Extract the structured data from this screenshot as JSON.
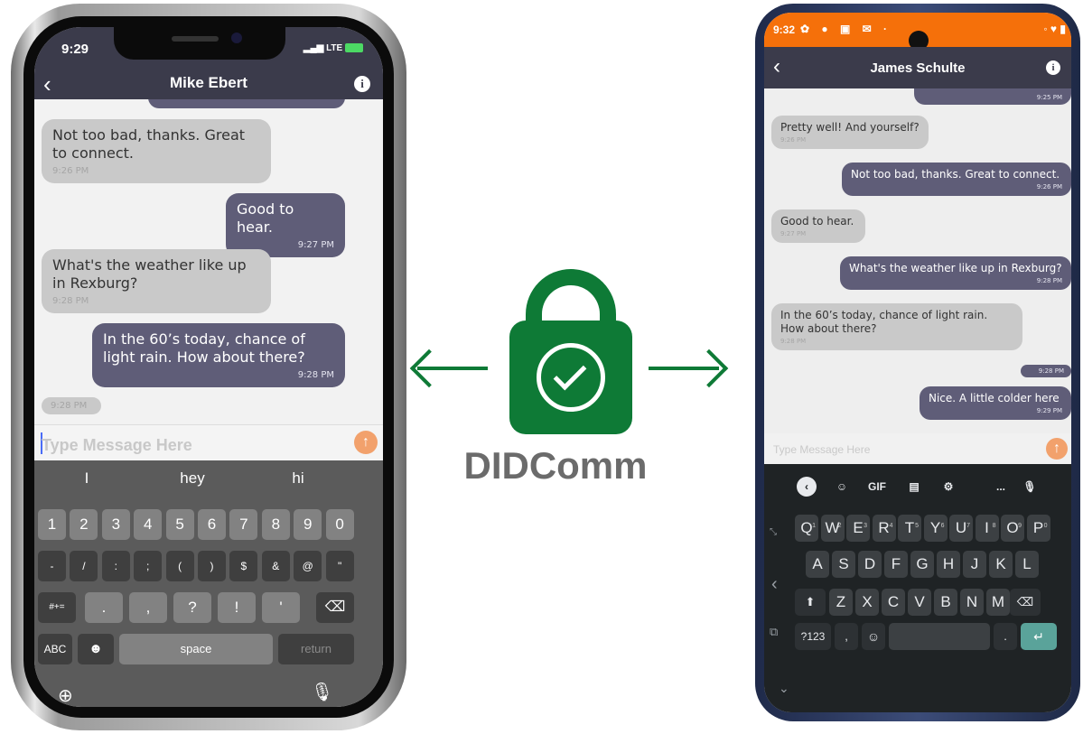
{
  "left_phone": {
    "status": {
      "time": "9:29",
      "carrier": "LTE"
    },
    "nav": {
      "title": "Mike Ebert"
    },
    "messages": [
      {
        "dir": "in",
        "text": "Not too bad, thanks. Great to connect.",
        "time": "9:26 PM"
      },
      {
        "dir": "out",
        "text": "Good to hear.",
        "time": "9:27 PM"
      },
      {
        "dir": "in",
        "text": "What's the weather like up in Rexburg?",
        "time": "9:28 PM"
      },
      {
        "dir": "out",
        "text": "In the 60’s today, chance of light rain. How about there?",
        "time": "9:28 PM"
      },
      {
        "dir": "in",
        "text": "",
        "time": "9:28 PM"
      }
    ],
    "input_placeholder": "Type Message Here",
    "keyboard": {
      "suggestions": [
        "I",
        "hey",
        "hi"
      ],
      "row1": [
        "1",
        "2",
        "3",
        "4",
        "5",
        "6",
        "7",
        "8",
        "9",
        "0"
      ],
      "row2": [
        "-",
        "/",
        ":",
        ";",
        "(",
        ")",
        "$",
        "&",
        "@",
        "\""
      ],
      "row3_left": "#+=",
      "row3": [
        ".",
        ",",
        "?",
        "!",
        "'"
      ],
      "abc": "ABC",
      "space": "space",
      "return": "return"
    }
  },
  "center": {
    "label": "DIDComm",
    "accent": "#0e7a36"
  },
  "right_phone": {
    "status": {
      "time": "9:32"
    },
    "nav": {
      "title": "James Schulte"
    },
    "messages": [
      {
        "dir": "out",
        "text": "",
        "time": "9:25 PM"
      },
      {
        "dir": "in",
        "text": "Pretty well! And yourself?",
        "time": "9:26 PM"
      },
      {
        "dir": "out",
        "text": "Not too bad, thanks. Great to connect.",
        "time": "9:26 PM"
      },
      {
        "dir": "in",
        "text": "Good to hear.",
        "time": "9:27 PM"
      },
      {
        "dir": "out",
        "text": "What's the weather like up in Rexburg?",
        "time": "9:28 PM"
      },
      {
        "dir": "in",
        "text": "In the 60’s today, chance of light rain. How about there?",
        "time": "9:28 PM"
      },
      {
        "dir": "out",
        "text": "",
        "time": "9:28 PM"
      },
      {
        "dir": "out",
        "text": "Nice. A little colder here",
        "time": "9:29 PM"
      }
    ],
    "input_placeholder": "Type Message Here",
    "keyboard": {
      "toolbar": [
        "GIF",
        "..."
      ],
      "row1": [
        "Q",
        "W",
        "E",
        "R",
        "T",
        "Y",
        "U",
        "I",
        "O",
        "P"
      ],
      "row1_nums": [
        "1",
        "2",
        "3",
        "4",
        "5",
        "6",
        "7",
        "8",
        "9",
        "0"
      ],
      "row2": [
        "A",
        "S",
        "D",
        "F",
        "G",
        "H",
        "J",
        "K",
        "L"
      ],
      "row3": [
        "Z",
        "X",
        "C",
        "V",
        "B",
        "N",
        "M"
      ],
      "sym": "?123",
      "comma": ",",
      "period": "."
    }
  }
}
